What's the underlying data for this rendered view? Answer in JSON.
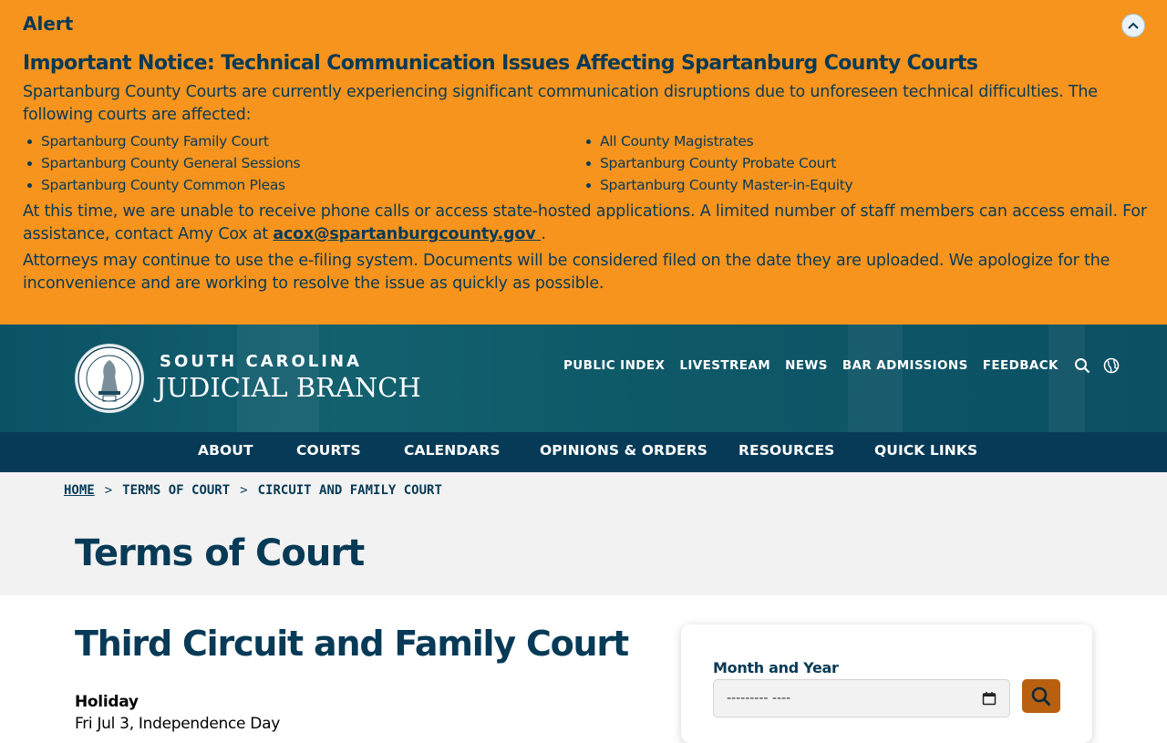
{
  "alert": {
    "title": "Alert",
    "heading": "Important Notice: Technical Communication Issues Affecting Spartanburg County Courts",
    "intro": "Spartanburg County Courts are currently experiencing significant communication disruptions due to unforeseen technical difficulties. The following courts are affected:",
    "courts_col1": [
      "Spartanburg County Family Court",
      "Spartanburg County General Sessions",
      "Spartanburg County Common Pleas"
    ],
    "courts_col2": [
      "All County Magistrates",
      "Spartanburg County Probate Court",
      "Spartanburg County Master-in-Equity"
    ],
    "contact_text": "At this time, we are unable to receive phone calls or access state-hosted applications. A limited number of staff members can access email. For assistance, contact Amy Cox at ",
    "contact_email": "acox@spartanburgcounty.gov ",
    "contact_end": ".",
    "closing": "Attorneys may continue to use the e-filing system. Documents will be considered filed on the date they are uploaded. We apologize for the inconvenience and are working to resolve the issue as quickly as possible.",
    "background_color": "#f7941d",
    "text_color": "#073a56"
  },
  "header": {
    "brand_top": "SOUTH CAROLINA",
    "brand_bottom": "JUDICIAL BRANCH",
    "seal_text": "SUPREME COURT OF SOUTH CAROLINA · NIL ULTRA",
    "utility_links": [
      "PUBLIC INDEX",
      "LIVESTREAM",
      "NEWS",
      "BAR ADMISSIONS",
      "FEEDBACK"
    ],
    "icons": [
      "search-icon",
      "globe-icon"
    ],
    "background_color": "#0b5366"
  },
  "mainnav": {
    "items": [
      "ABOUT",
      "COURTS",
      "CALENDARS",
      "OPINIONS & ORDERS",
      "RESOURCES",
      "QUICK LINKS"
    ],
    "background_color": "#073a56"
  },
  "breadcrumb": {
    "home": "HOME",
    "items": [
      "TERMS OF COURT",
      "CIRCUIT AND FAMILY COURT"
    ],
    "separator": ">"
  },
  "page": {
    "title": "Terms of Court",
    "section_title": "Third Circuit and Family Court",
    "holiday_label": "Holiday",
    "holiday_item": "Fri Jul 3, Independence Day"
  },
  "filter": {
    "label": "Month and Year",
    "placeholder": "--------- ----",
    "search_button_color": "#b8600f"
  }
}
